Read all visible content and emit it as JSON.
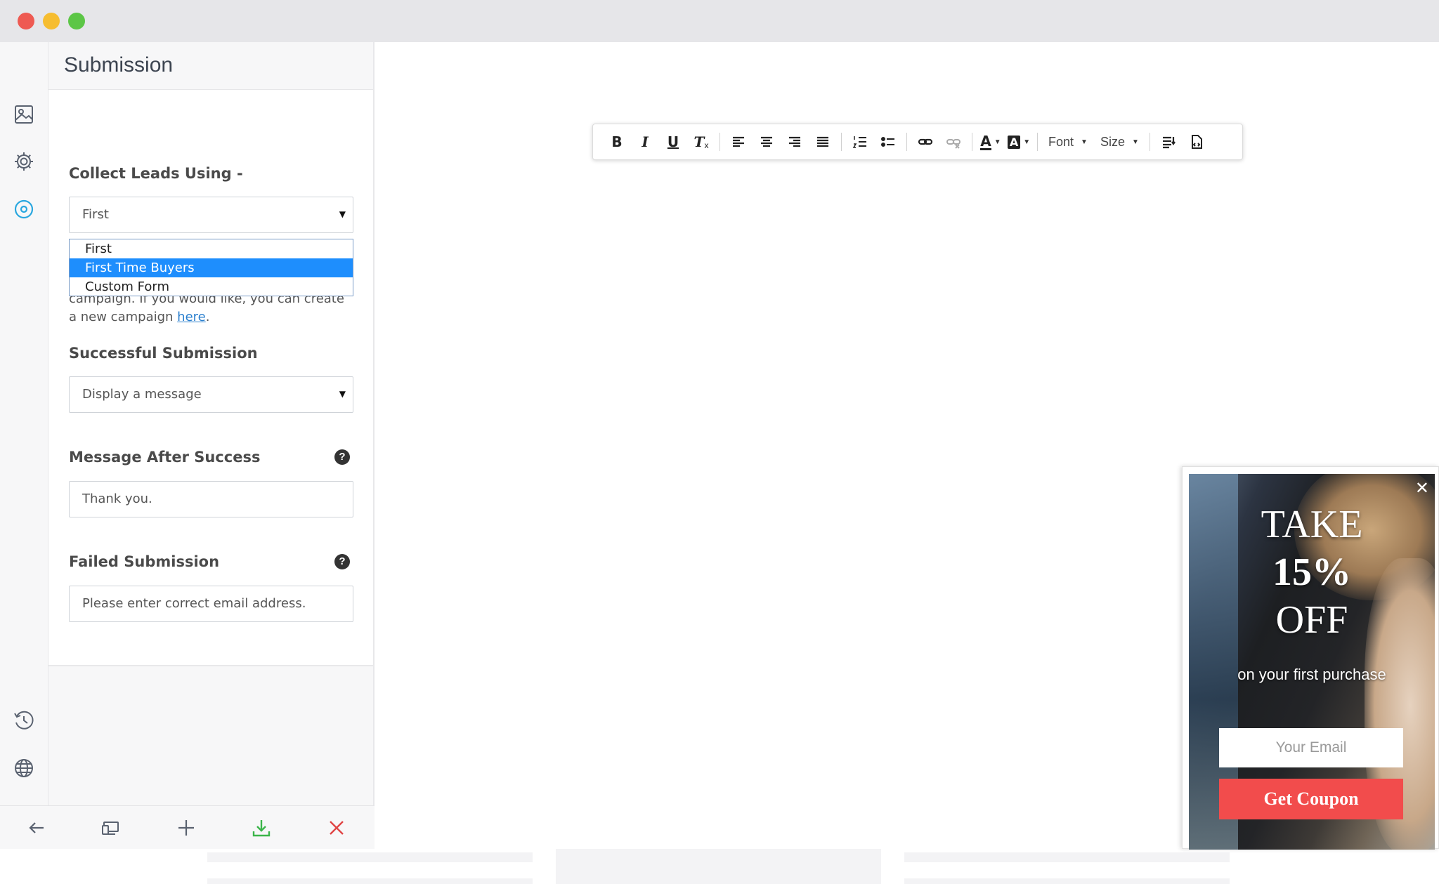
{
  "panel": {
    "title": "Submission",
    "collect_label": "Collect Leads Using -",
    "collect_value": "First",
    "dropdown_options": [
      "First",
      "First Time Buyers",
      "Custom Form"
    ],
    "selected_option_index": 1,
    "note_text": "campaign. If you would like, you can create a new campaign ",
    "note_link": "here",
    "note_end": ".",
    "success_label": "Successful Submission",
    "success_value": "Display a message",
    "message_label": "Message After Success",
    "message_value": "Thank you.",
    "failed_label": "Failed Submission",
    "failed_value": "Please enter correct email address.",
    "help_glyph": "?"
  },
  "editor_toolbar": {
    "font_label": "Font",
    "size_label": "Size"
  },
  "popup": {
    "line1": "TAKE",
    "line2": "15%",
    "line3": "OFF",
    "subtitle": "on your first purchase",
    "email_placeholder": "Your Email",
    "button_label": "Get Coupon",
    "close_glyph": "✕"
  },
  "colors": {
    "accent_blue": "#1e8efd",
    "coupon_red": "#f24c4c",
    "download_green": "#3bb54a",
    "close_red": "#e04545"
  }
}
